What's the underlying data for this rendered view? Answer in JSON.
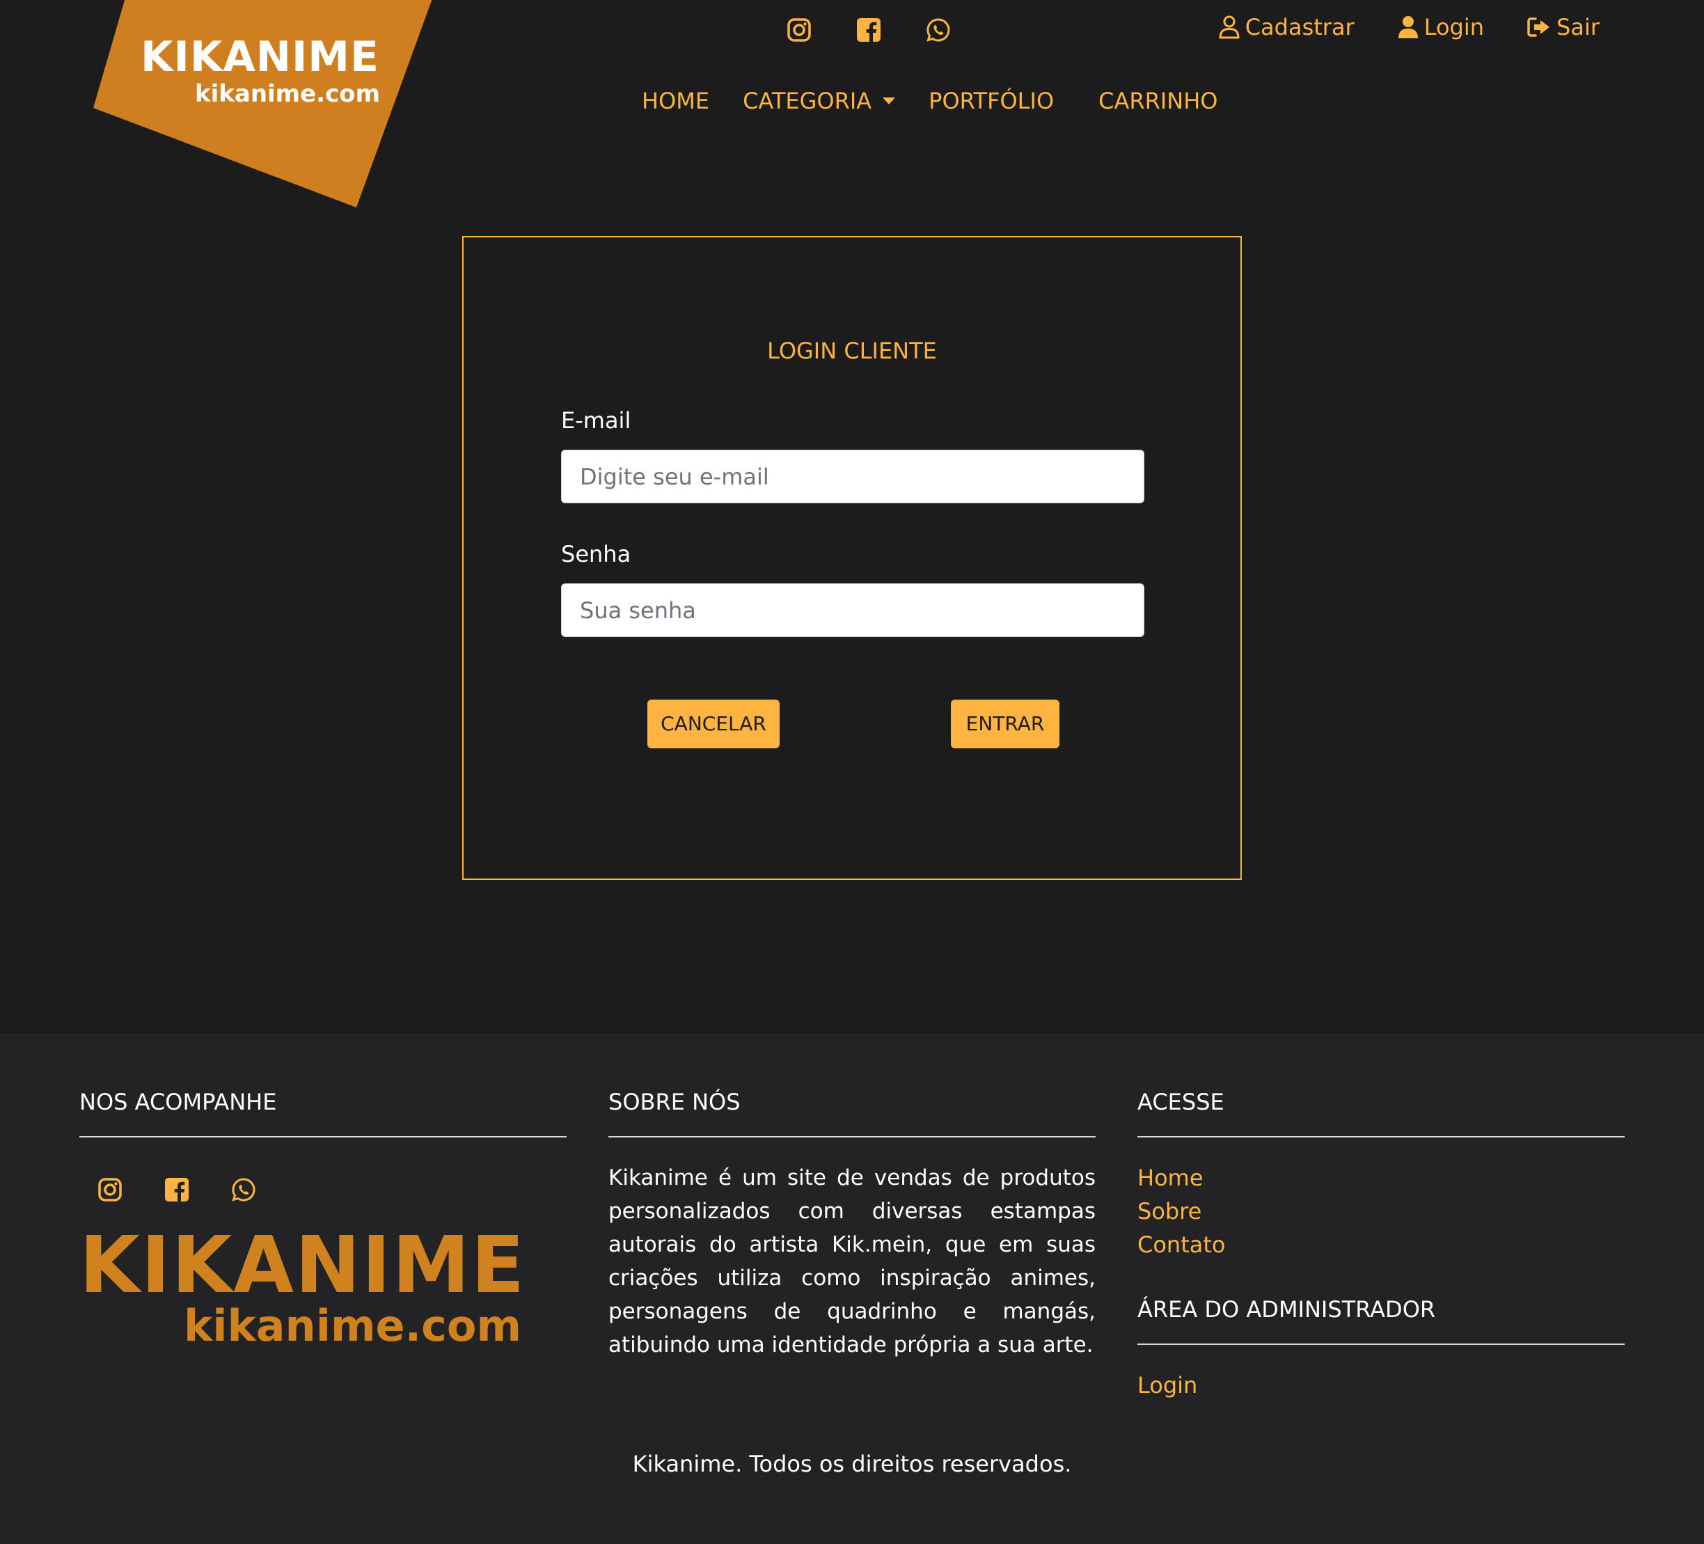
{
  "brand": {
    "name": "KIKANIME",
    "domain": "kikanime.com",
    "logo_color": "#cf7f20"
  },
  "colors": {
    "accent": "#ffb441",
    "background": "#1c1c1d",
    "footer_bg": "#232224"
  },
  "header": {
    "social_icons": [
      "instagram-icon",
      "facebook-icon",
      "whatsapp-icon"
    ],
    "user_links": {
      "register": "Cadastrar",
      "login": "Login",
      "logout": "Sair"
    },
    "nav": {
      "home": "HOME",
      "category": "CATEGORIA",
      "portfolio": "PORTFÓLIO",
      "cart": "CARRINHO"
    }
  },
  "login": {
    "title": "LOGIN CLIENTE",
    "email_label": "E-mail",
    "email_placeholder": "Digite seu e-mail",
    "password_label": "Senha",
    "password_placeholder": "Sua senha",
    "cancel_label": "CANCELAR",
    "submit_label": "ENTRAR"
  },
  "footer": {
    "follow_heading": "NOS ACOMPANHE",
    "about_heading": "SOBRE NÓS",
    "about_text": "Kikanime é um site de vendas de produtos personalizados com diversas estampas autorais do artista Kik.mein, que em suas criações utiliza como inspiração animes, personagens de quadrinho e mangás, atibuindo uma identidade própria a sua arte.",
    "access_heading": "ACESSE",
    "access_links": [
      "Home",
      "Sobre",
      "Contato"
    ],
    "admin_heading": "ÁREA DO ADMINISTRADOR",
    "admin_login": "Login",
    "copyright": "Kikanime. Todos os direitos reservados."
  }
}
